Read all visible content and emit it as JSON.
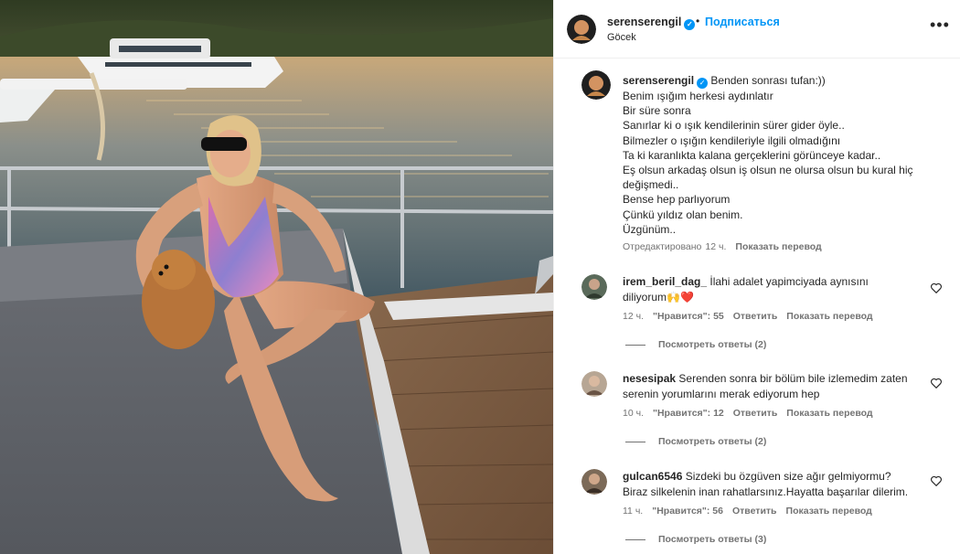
{
  "post": {
    "username": "serenserengil",
    "follow_label": "Подписаться",
    "dot": "•",
    "location": "Göcek",
    "more_label": "•••"
  },
  "caption": {
    "username": "serenserengil",
    "first": "Benden sonrası tufan:))",
    "lines": [
      "Benim ışığım herkesi aydınlatır",
      "Bir süre sonra",
      "Sanırlar ki o ışık kendilerinin sürer gider öyle..",
      "Bilmezler o ışığın kendileriyle ilgili olmadığını",
      "Ta ki karanlıkta kalana gerçeklerini görünceye kadar..",
      "Eş olsun arkadaş olsun iş olsun ne olursa olsun bu kural hiç değişmedi..",
      "Bense hep parlıyorum",
      "Çünkü yıldız olan benim.",
      "Üzgünüm.."
    ],
    "edited": "Отредактировано",
    "time": "12 ч.",
    "translate": "Показать перевод"
  },
  "comments": [
    {
      "username": "irem_beril_dag_",
      "text": "İlahi adalet yapimciyada aynısını diliyorum🙌❤️",
      "time": "12 ч.",
      "likes": "\"Нравится\": 55",
      "reply": "Ответить",
      "translate": "Показать перевод",
      "view_replies": "Посмотреть ответы (2)"
    },
    {
      "username": "nesesipak",
      "text": "Serenden sonra bir bölüm bile izlemedim zaten serenin yorumlarını merak ediyorum hep",
      "time": "10 ч.",
      "likes": "\"Нравится\": 12",
      "reply": "Ответить",
      "translate": "Показать перевод",
      "view_replies": "Посмотреть ответы (2)"
    },
    {
      "username": "gulcan6546",
      "text": "Sizdeki bu özgüven size ağır gelmiyormu? Biraz silkelenin inan rahatlarsınız.Hayatta başarılar dilerim.",
      "time": "11 ч.",
      "likes": "\"Нравится\": 56",
      "reply": "Ответить",
      "translate": "Показать перевод",
      "view_replies": "Посмотреть ответы (3)"
    }
  ],
  "icons": {
    "verified": "verified-badge-icon",
    "heart": "heart-outline-icon",
    "more": "more-options-icon"
  },
  "colors": {
    "accent": "#0095f6",
    "muted": "#737373",
    "text": "#262626"
  }
}
